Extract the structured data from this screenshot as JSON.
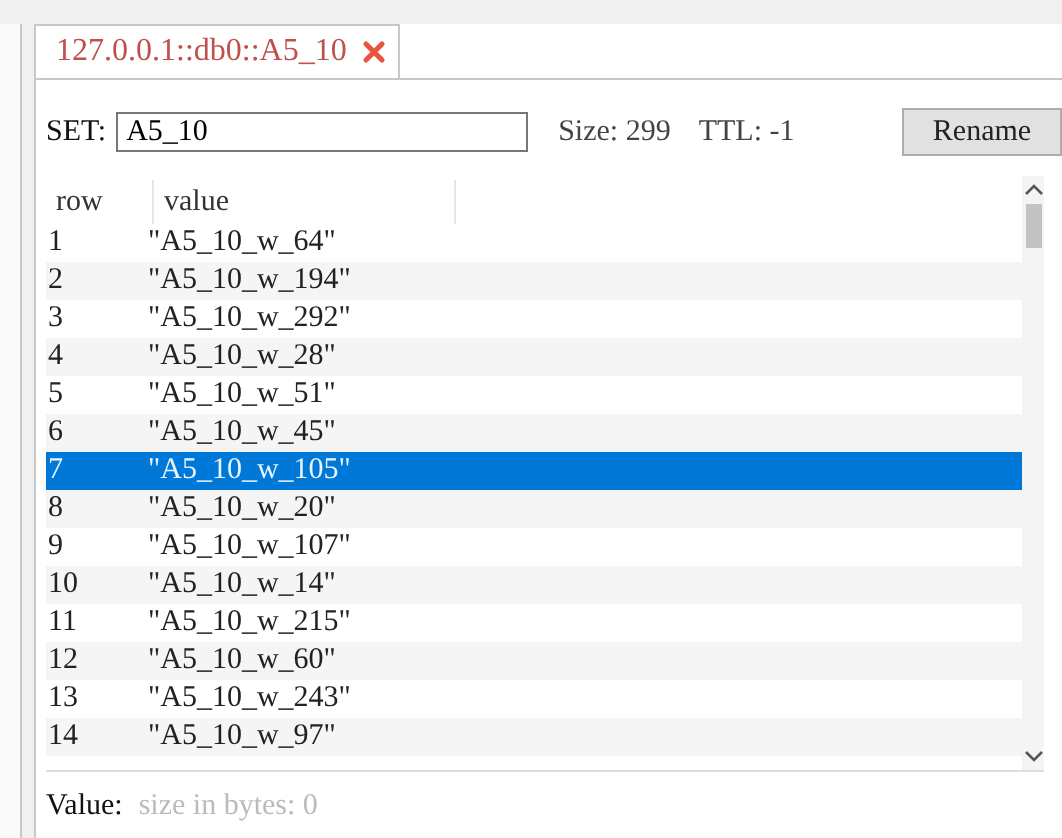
{
  "tab": {
    "title": "127.0.0.1::db0::A5_10",
    "selected": true
  },
  "key_bar": {
    "type_label": "SET:",
    "key_value": "A5_10",
    "size": "Size: 299",
    "ttl": "TTL: -1",
    "rename_button": "Rename"
  },
  "table": {
    "columns": [
      "row",
      "value"
    ],
    "rows": [
      {
        "row": "1",
        "value": "\"A5_10_w_64\"",
        "selected": false
      },
      {
        "row": "2",
        "value": "\"A5_10_w_194\"",
        "selected": false
      },
      {
        "row": "3",
        "value": "\"A5_10_w_292\"",
        "selected": false
      },
      {
        "row": "4",
        "value": "\"A5_10_w_28\"",
        "selected": false
      },
      {
        "row": "5",
        "value": "\"A5_10_w_51\"",
        "selected": false
      },
      {
        "row": "6",
        "value": "\"A5_10_w_45\"",
        "selected": false
      },
      {
        "row": "7",
        "value": "\"A5_10_w_105\"",
        "selected": true
      },
      {
        "row": "8",
        "value": "\"A5_10_w_20\"",
        "selected": false
      },
      {
        "row": "9",
        "value": "\"A5_10_w_107\"",
        "selected": false
      },
      {
        "row": "10",
        "value": "\"A5_10_w_14\"",
        "selected": false
      },
      {
        "row": "11",
        "value": "\"A5_10_w_215\"",
        "selected": false
      },
      {
        "row": "12",
        "value": "\"A5_10_w_60\"",
        "selected": false
      },
      {
        "row": "13",
        "value": "\"A5_10_w_243\"",
        "selected": false
      },
      {
        "row": "14",
        "value": "\"A5_10_w_97\"",
        "selected": false
      }
    ]
  },
  "value_panel": {
    "label": "Value:",
    "placeholder": "size in bytes: 0"
  }
}
